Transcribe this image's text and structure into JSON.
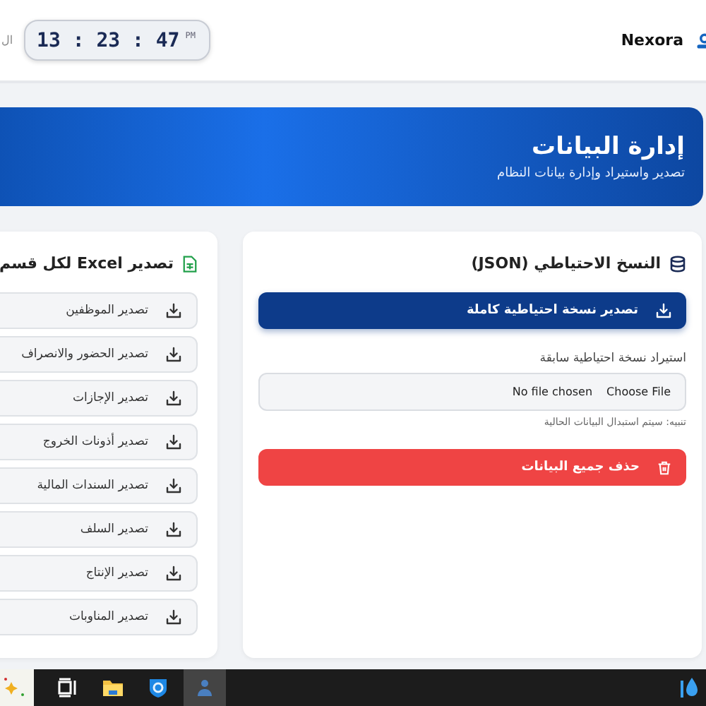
{
  "header": {
    "brand": "Nexora",
    "clock": {
      "time": "13 : 23 : 47",
      "period": "PM"
    },
    "cut_text": "ال"
  },
  "banner": {
    "title": "إدارة البيانات",
    "subtitle": "تصدير واستيراد وإدارة بيانات النظام"
  },
  "backup_card": {
    "title": "النسخ الاحتياطي (JSON)",
    "export_button": "تصدير نسخة احتياطية كاملة",
    "import_label": "استيراد نسخة احتياطية سابقة",
    "file_input": {
      "button": "Choose File",
      "status": "No file chosen"
    },
    "warning": "تنبيه: سيتم استبدال البيانات الحالية",
    "delete_button": "حذف جميع البيانات"
  },
  "excel_card": {
    "title": "تصدير Excel لكل قسم",
    "items": [
      "تصدير الموظفين",
      "تصدير الحضور والانصراف",
      "تصدير الإجازات",
      "تصدير أذونات الخروج",
      "تصدير السندات المالية",
      "تصدير السلف",
      "تصدير الإنتاج",
      "تصدير المناوبات"
    ]
  }
}
